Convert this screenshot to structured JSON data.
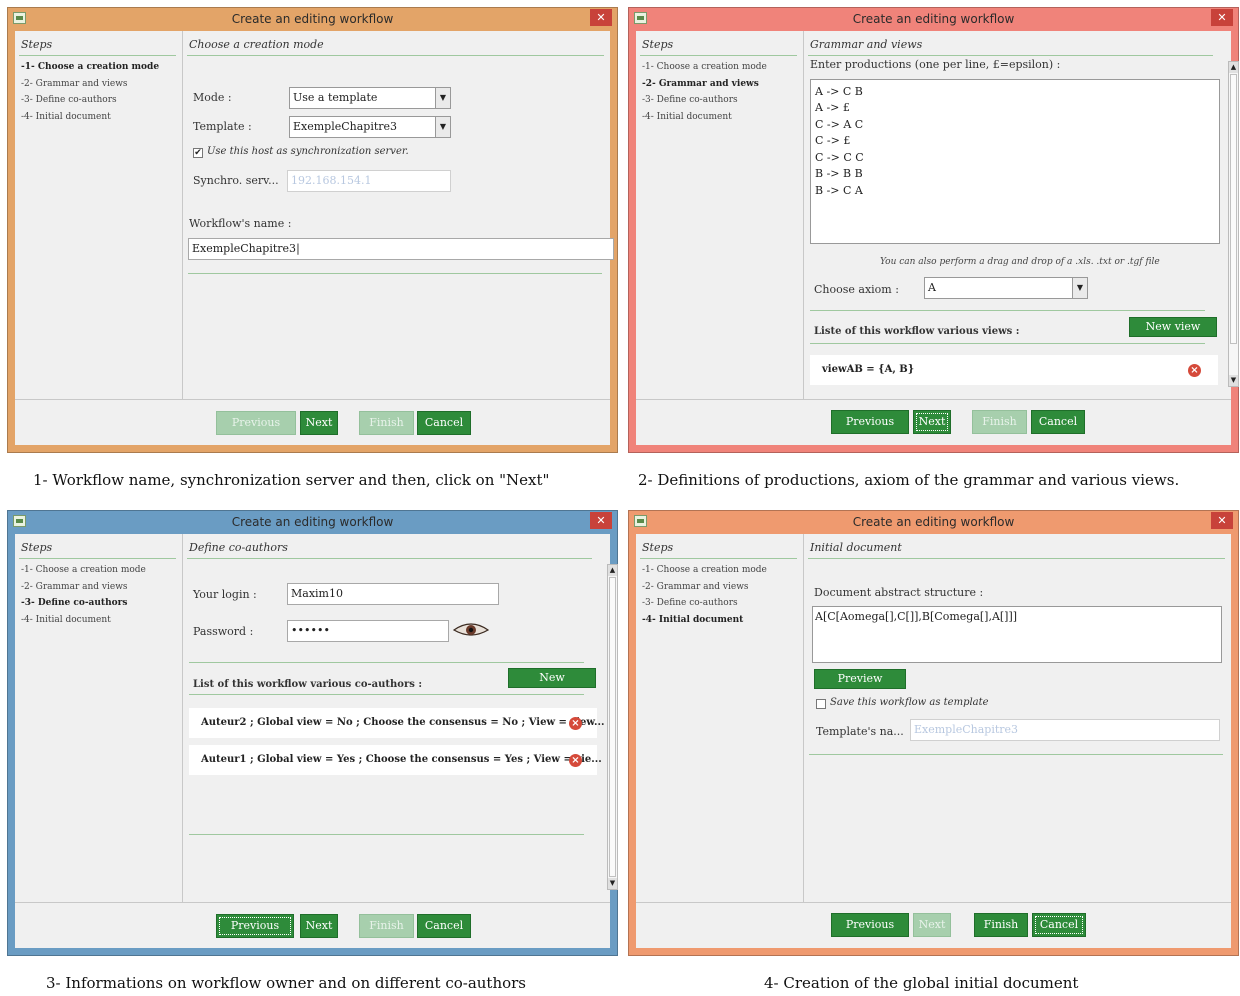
{
  "window_title": "Create an editing workflow",
  "close_glyph": "✕",
  "steps_header": "Steps",
  "steps": [
    "-1- Choose a creation mode",
    "-2- Grammar and views",
    "-3- Define co-authors",
    "-4- Initial document"
  ],
  "buttons": {
    "previous": "Previous",
    "next": "Next",
    "finish": "Finish",
    "cancel": "Cancel"
  },
  "colors": {
    "win1": "#e3a468",
    "win2": "#f0837a",
    "win3": "#6a9cc3",
    "win4": "#ef9a6f",
    "accent": "#2e8b3a"
  },
  "panel1": {
    "title": "Choose a creation mode",
    "mode_label": "Mode :",
    "mode_value": "Use a template",
    "template_label": "Template :",
    "template_value": "ExempleChapitre3",
    "sync_checkbox_label": "Use this host as synchronization server.",
    "sync_checked": true,
    "sync_label": "Synchro. serv...",
    "sync_value": "192.168.154.1",
    "workflow_name_label": "Workflow's name :",
    "workflow_name_value": "ExempleChapitre3"
  },
  "panel2": {
    "title": "Grammar and views",
    "productions_label": "Enter productions (one per line, £=epsilon) :",
    "productions": [
      "A -> C B",
      "A -> £",
      "C -> A C",
      "C -> £",
      "C -> C C",
      "B -> B B",
      "B -> C A"
    ],
    "drag_hint": "You can also perform a drag and drop of a .xls. .txt or .tgf file",
    "axiom_label": "Choose axiom :",
    "axiom_value": "A",
    "views_label": "Liste of this workflow various views :",
    "new_view_button": "New view",
    "views": [
      "viewAB = {A, B}"
    ]
  },
  "panel3": {
    "title": "Define co-authors",
    "login_label": "Your login :",
    "login_value": "Maxim10",
    "password_label": "Password :",
    "password_value": "••••••",
    "eye_icon": "eye-icon",
    "coauthors_label": "List of this workflow various co-authors :",
    "new_button": "New",
    "coauthors": [
      "Auteur2 ; Global view = No ; Choose the consensus = No ; View = view...",
      "Auteur1 ; Global view = Yes ; Choose the consensus = Yes ; View = vie..."
    ]
  },
  "panel4": {
    "title": "Initial document",
    "structure_label": "Document abstract structure :",
    "structure_value": "A[C[Aomega[],C[]],B[Comega[],A[]]]",
    "preview_button": "Preview",
    "save_template_label": "Save this workflow as template",
    "save_template_checked": false,
    "template_name_label": "Template's na...",
    "template_name_placeholder": "ExempleChapitre3"
  },
  "captions": [
    "1- Workflow name, synchronization server and then, click on \"Next\"",
    "2- Definitions of productions, axiom of the grammar and various views.",
    "3- Informations on workflow owner and on different co-authors",
    "4- Creation of the global initial document"
  ]
}
